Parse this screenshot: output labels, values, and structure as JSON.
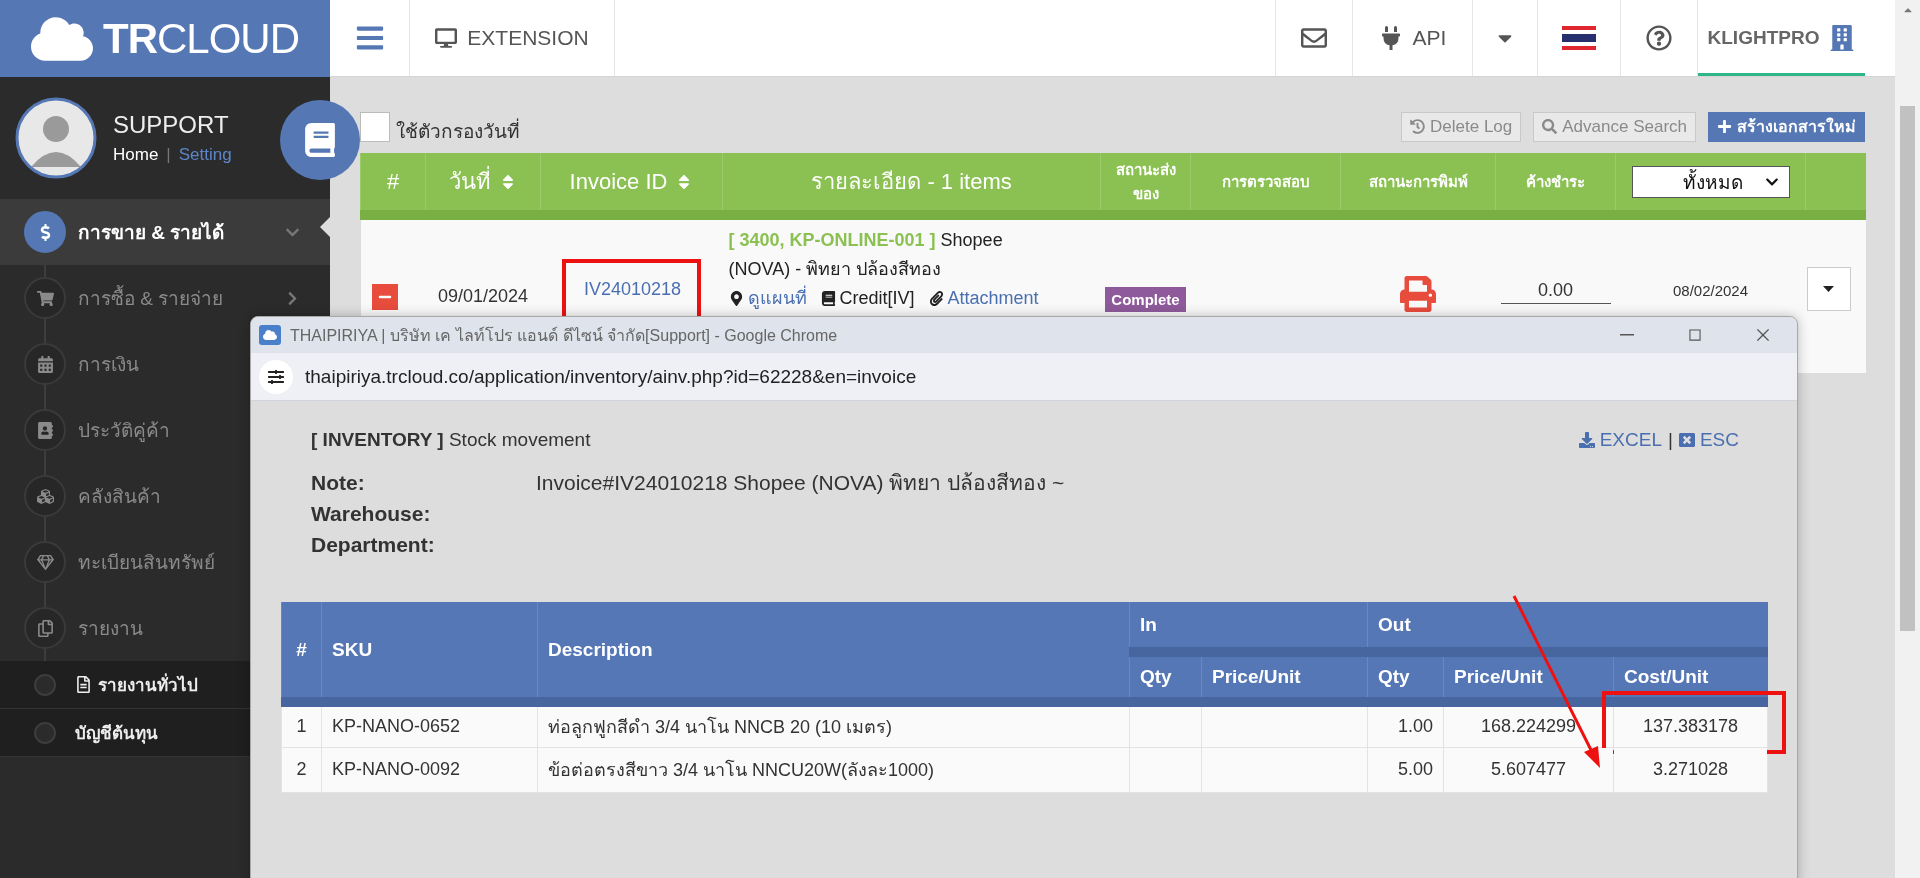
{
  "logo": "**TR**CLOUD",
  "topbar": {
    "extension": "EXTENSION",
    "api": "API",
    "user": "KLIGHTPRO"
  },
  "profile": {
    "name": "SUPPORT",
    "home": "Home",
    "separator": "|",
    "setting": "Setting"
  },
  "sidebar": {
    "items": [
      {
        "label": "การขาย & รายได้",
        "selected": true,
        "expanded": true
      },
      {
        "label": "การซื้อ & รายจ่าย",
        "selected": false,
        "expanded": false
      },
      {
        "label": "การเงิน",
        "selected": false
      },
      {
        "label": "ประวัติคู่ค้า",
        "selected": false
      },
      {
        "label": "คลังสินค้า",
        "selected": false
      },
      {
        "label": "ทะเบียนสินทรัพย์",
        "selected": false
      },
      {
        "label": "รายงาน",
        "selected": false,
        "children": [
          {
            "label": "รายงานทั่วไป",
            "kind": "document"
          },
          {
            "label": "บัญชีต้นทุน",
            "kind": "plain"
          }
        ]
      }
    ]
  },
  "main": {
    "date_filter": {
      "label": "ใช้ตัวกรองวันที่",
      "checked": false
    },
    "actions": [
      {
        "label": "Delete Log",
        "kind": "history"
      },
      {
        "label": "Advance Search",
        "kind": "search"
      },
      {
        "label": "สร้างเอกสารใหม่",
        "kind": "create"
      }
    ],
    "columns": [
      {
        "label": "#",
        "sortable": false
      },
      {
        "label": "วันที่",
        "sortable": true
      },
      {
        "label": "Invoice ID",
        "sortable": true
      },
      {
        "label": "รายละเอียด - 1 items",
        "sortable": false
      },
      {
        "label": "สถานะส่งของ",
        "sortable": false
      },
      {
        "label": "การตรวจสอบ",
        "sortable": false
      },
      {
        "label": "สถานะการพิมพ์",
        "sortable": false
      },
      {
        "label": "ค้างชำระ",
        "sortable": false
      }
    ],
    "status_filter": {
      "value": "ทั้งหมด"
    },
    "rows": [
      {
        "date": "09/01/2024",
        "invoice_id": "IV24010218",
        "highlighted": true,
        "code": "[ 3400, KP-ONLINE-001 ]",
        "customer_line1": "Shopee",
        "customer_line2": "(NOVA) - พิทยา ปล้องสีทอง",
        "links": [
          {
            "label": "ดูแผนที่",
            "kind": "map"
          },
          {
            "label": "Credit[IV]",
            "kind": "credit"
          },
          {
            "label": "Attachment",
            "kind": "attachment"
          }
        ],
        "delivery_status": "Complete",
        "balance": "0.00",
        "due_date": "08/02/2024"
      }
    ]
  },
  "popup": {
    "title": "THAIPIRIYA | บริษัท เค ไลท์โปร แอนด์ ดีไซน์ จำกัด[Support] - Google Chrome",
    "url": "thaipiriya.trcloud.co/application/inventory/ainv.php?id=62228&en=invoice",
    "heading": "**[ INVENTORY ]** Stock movement",
    "exports": [
      {
        "label": "EXCEL",
        "kind": "excel"
      },
      {
        "label": "ESC",
        "kind": "close"
      }
    ],
    "export_separator": "|",
    "fields": [
      {
        "label": "Note:",
        "value": "Invoice#IV24010218 Shopee (NOVA) พิทยา ปล้องสีทอง ~"
      },
      {
        "label": "Warehouse:"
      },
      {
        "label": "Department:"
      }
    ],
    "stock": {
      "columns": [
        "#",
        "SKU",
        "Description"
      ],
      "groups": [
        {
          "label": "In",
          "columns": [
            "Qty",
            "Price/Unit"
          ]
        },
        {
          "label": "Out",
          "columns": [
            "Qty",
            "Price/Unit",
            "Cost/Unit"
          ]
        }
      ],
      "rows": [
        {
          "no": "1",
          "sku": "KP-NANO-0652",
          "description": "ท่อลูกฟูกสีดำ 3/4 นาโน NNCB 20 (10 เมตร)",
          "out_qty": "1.00",
          "out_price": "168.224299",
          "cost": "137.383178",
          "highlighted": true
        },
        {
          "no": "2",
          "sku": "KP-NANO-0092",
          "description": "ข้อต่อตรงสีขาว 3/4 นาโน NNCU20W(ลังละ1000)",
          "out_qty": "5.00",
          "out_price": "5.607477",
          "cost": "3.271028",
          "highlighted": false
        }
      ]
    }
  }
}
